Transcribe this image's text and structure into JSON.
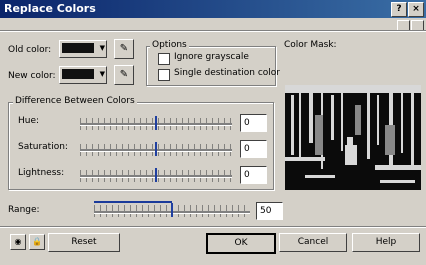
{
  "window": {
    "title": "Replace Colors",
    "help_btn": "?",
    "close_btn": "×"
  },
  "colors": {
    "old_label": "Old color:",
    "new_label": "New color:",
    "old_value": "#111111",
    "new_value": "#111111"
  },
  "options": {
    "legend": "Options",
    "ignore_grayscale": "Ignore grayscale",
    "single_destination": "Single destination color"
  },
  "difference": {
    "legend": "Difference Between Colors",
    "hue_label": "Hue:",
    "hue_value": "0",
    "saturation_label": "Saturation:",
    "saturation_value": "0",
    "lightness_label": "Lightness:",
    "lightness_value": "0"
  },
  "color_mask": {
    "label": "Color Mask:"
  },
  "range": {
    "label": "Range:",
    "value": "50"
  },
  "buttons": {
    "reset": "Reset",
    "ok": "OK",
    "cancel": "Cancel",
    "help": "Help"
  }
}
